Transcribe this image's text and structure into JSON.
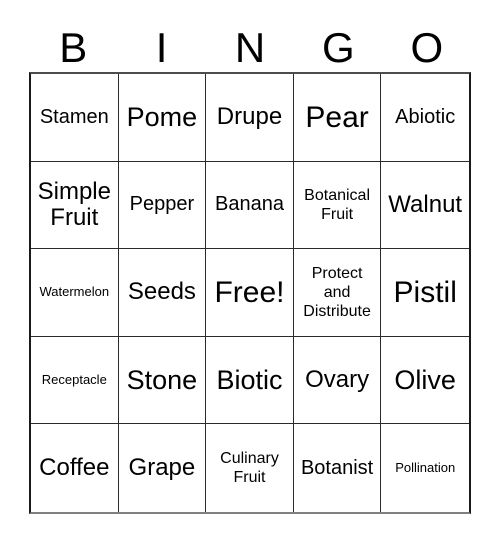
{
  "card": {
    "title": "Bingo Card",
    "header_letters": [
      "B",
      "I",
      "N",
      "G",
      "O"
    ],
    "columns": 5,
    "rows": 5,
    "colors": {
      "background": "#ffffff",
      "text": "#000000",
      "grid_line": "#2b2b2b",
      "outer_border": "#1a1a1a"
    },
    "cells": [
      {
        "text": "Stamen",
        "size": "sm"
      },
      {
        "text": "Pome",
        "size": "lg"
      },
      {
        "text": "Drupe",
        "size": "md"
      },
      {
        "text": "Pear",
        "size": "xl"
      },
      {
        "text": "Abiotic",
        "size": "sm"
      },
      {
        "text": "Simple\nFruit",
        "size": "md"
      },
      {
        "text": "Pepper",
        "size": "sm"
      },
      {
        "text": "Banana",
        "size": "sm"
      },
      {
        "text": "Botanical\nFruit",
        "size": "xs"
      },
      {
        "text": "Walnut",
        "size": "md"
      },
      {
        "text": "Watermelon",
        "size": "xxs"
      },
      {
        "text": "Seeds",
        "size": "md"
      },
      {
        "text": "Free!",
        "size": "xl"
      },
      {
        "text": "Protect\nand\nDistribute",
        "size": "xs"
      },
      {
        "text": "Pistil",
        "size": "xl"
      },
      {
        "text": "Receptacle",
        "size": "xxs"
      },
      {
        "text": "Stone",
        "size": "lg"
      },
      {
        "text": "Biotic",
        "size": "lg"
      },
      {
        "text": "Ovary",
        "size": "md"
      },
      {
        "text": "Olive",
        "size": "lg"
      },
      {
        "text": "Coffee",
        "size": "md"
      },
      {
        "text": "Grape",
        "size": "md"
      },
      {
        "text": "Culinary\nFruit",
        "size": "xs"
      },
      {
        "text": "Botanist",
        "size": "sm"
      },
      {
        "text": "Pollination",
        "size": "xxs"
      }
    ]
  }
}
